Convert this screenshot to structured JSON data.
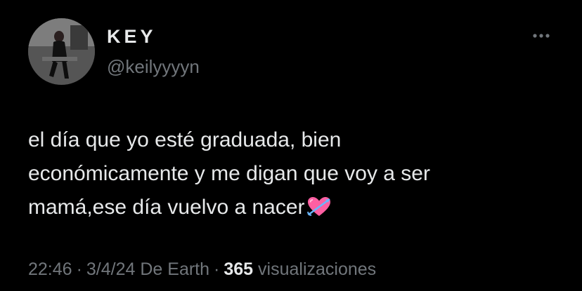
{
  "author": {
    "display_name": "KEY",
    "handle": "@keilyyyyn",
    "avatar_icon": "profile-photo"
  },
  "more_icon": "more-options-icon",
  "tweet": {
    "lines": [
      "el día que yo esté graduada, bien",
      "económicamente y me digan que voy a ser",
      "mamá,ese día vuelvo a nacer"
    ],
    "emoji_icon": "heart-with-arrow-emoji"
  },
  "meta": {
    "time": "22:46",
    "date": "3/4/24",
    "source": "De Earth",
    "views_count": "365",
    "views_label": "visualizaciones",
    "separator": "·"
  },
  "colors": {
    "background": "#000000",
    "primary_text": "#e7e9ea",
    "secondary_text": "#71767b",
    "emoji_pink": "#ff5fa2",
    "emoji_arrow": "#6ab7ff"
  }
}
